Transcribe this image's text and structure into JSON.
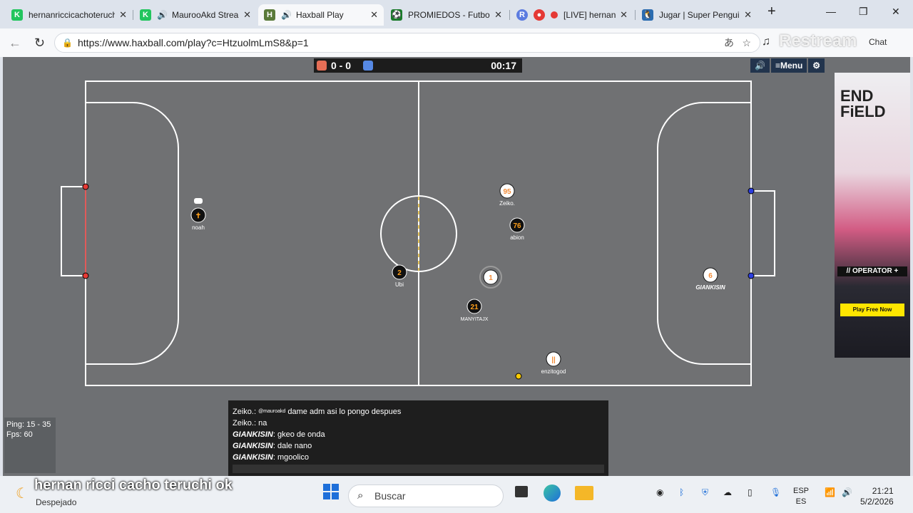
{
  "tabs": [
    {
      "title": "hernanriccicachoteruchi",
      "fav": "K",
      "fav_color": "#22c55e"
    },
    {
      "title": "MaurooAkd Stream",
      "fav": "K",
      "fav_color": "#22c55e",
      "sound": true
    },
    {
      "title": "Haxball Play",
      "fav": "H",
      "fav_color": "#5a7a3a",
      "sound": true,
      "active": true
    },
    {
      "title": "PROMIEDOS - Futbol",
      "fav": "⚽",
      "fav_color": "#1a7a2a"
    },
    {
      "title": "[LIVE] hernan",
      "fav": "●",
      "fav_color": "#e53935"
    },
    {
      "title": "Jugar | Super Penguin",
      "fav": "🐧",
      "fav_color": "#2b6cb0"
    }
  ],
  "address": {
    "url": "https://www.haxball.com/play?c=HtzuolmLmS8&p=1"
  },
  "overlay": {
    "restream": "Restream",
    "chat_label": "Chat"
  },
  "score": {
    "red": 0,
    "sep": "-",
    "blue": 0,
    "text": "0 - 0",
    "time": "00:17"
  },
  "menu": {
    "menu_label": "≡Menu"
  },
  "players": [
    {
      "num": "",
      "name": "noah",
      "team": "red"
    },
    {
      "num": "2",
      "name": "Ubi",
      "team": "red"
    },
    {
      "num": "21",
      "name": "MANYITAJX",
      "team": "red"
    },
    {
      "num": "76",
      "name": "abion",
      "team": "red"
    },
    {
      "num": "95",
      "name": "Zeiko.",
      "team": "blue"
    },
    {
      "num": "",
      "name": "enzitogod",
      "team": "blue"
    },
    {
      "num": "6",
      "name": "GIANKISIN",
      "team": "blue"
    }
  ],
  "ad": {
    "brand_line1": "END",
    "brand_line2": "FiELD",
    "operator": "// OPERATOR +",
    "play": "Play Free Now"
  },
  "stats": {
    "ping": "Ping: 15 - 35",
    "fps": "Fps: 60"
  },
  "chat": [
    {
      "who": "Zeiko.:",
      "mention": "@mauroakd",
      "text": " dame adm asi lo pongo despues"
    },
    {
      "who": "Zeiko.:",
      "mention": "",
      "text": " na"
    },
    {
      "who": "GIANKISIN",
      "mention": "",
      "text": ": gkeo de onda"
    },
    {
      "who": "GIANKISIN",
      "mention": "",
      "text": ": dale nano"
    },
    {
      "who": "GIANKISIN",
      "mention": "",
      "text": ": mgoolico"
    }
  ],
  "taskbar": {
    "caption": "hernan ricci cacho teruchi ok",
    "weather": "Despejado",
    "search_placeholder": "Buscar",
    "lang1": "ESP",
    "lang2": "ES",
    "time": "21:21",
    "date": "5/2/2026"
  }
}
